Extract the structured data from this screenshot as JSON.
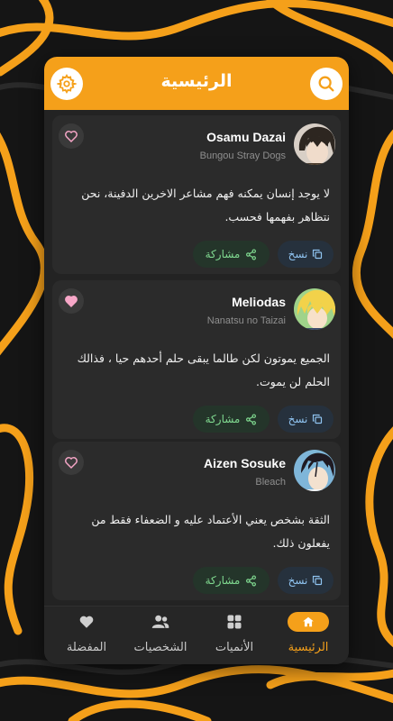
{
  "header": {
    "title": "الرئيسية",
    "search_icon": "search-icon",
    "settings_icon": "gear-icon"
  },
  "colors": {
    "accent": "#f5a01a",
    "card": "#2b2b2b",
    "share_text": "#7fd88f",
    "copy_text": "#8fc3f0"
  },
  "cards": [
    {
      "name": "Osamu Dazai",
      "series": "Bungou Stray Dogs",
      "quote": "لا يوجد إنسان يمكنه فهم مشاعر الاخرين الدفينة، نحن نتظاهر بفهمها فحسب.",
      "favorited": false,
      "share_label": "مشاركة",
      "copy_label": "نسخ"
    },
    {
      "name": "Meliodas",
      "series": "Nanatsu no Taizai",
      "quote": "الجميع يموتون لكن طالما يبقى حلم أحدهم حيا ، فذالك الحلم لن يموت.",
      "favorited": true,
      "share_label": "مشاركة",
      "copy_label": "نسخ"
    },
    {
      "name": "Aizen Sosuke",
      "series": "Bleach",
      "quote": "الثقة بشخص يعني الأعتماد عليه و الضعفاء فقط من يفعلون ذلك.",
      "favorited": false,
      "share_label": "مشاركة",
      "copy_label": "نسخ"
    }
  ],
  "nav": {
    "home": "الرئيسية",
    "animes": "الأنميات",
    "characters": "الشخصيات",
    "favorites": "المفضلة",
    "active": "home"
  }
}
